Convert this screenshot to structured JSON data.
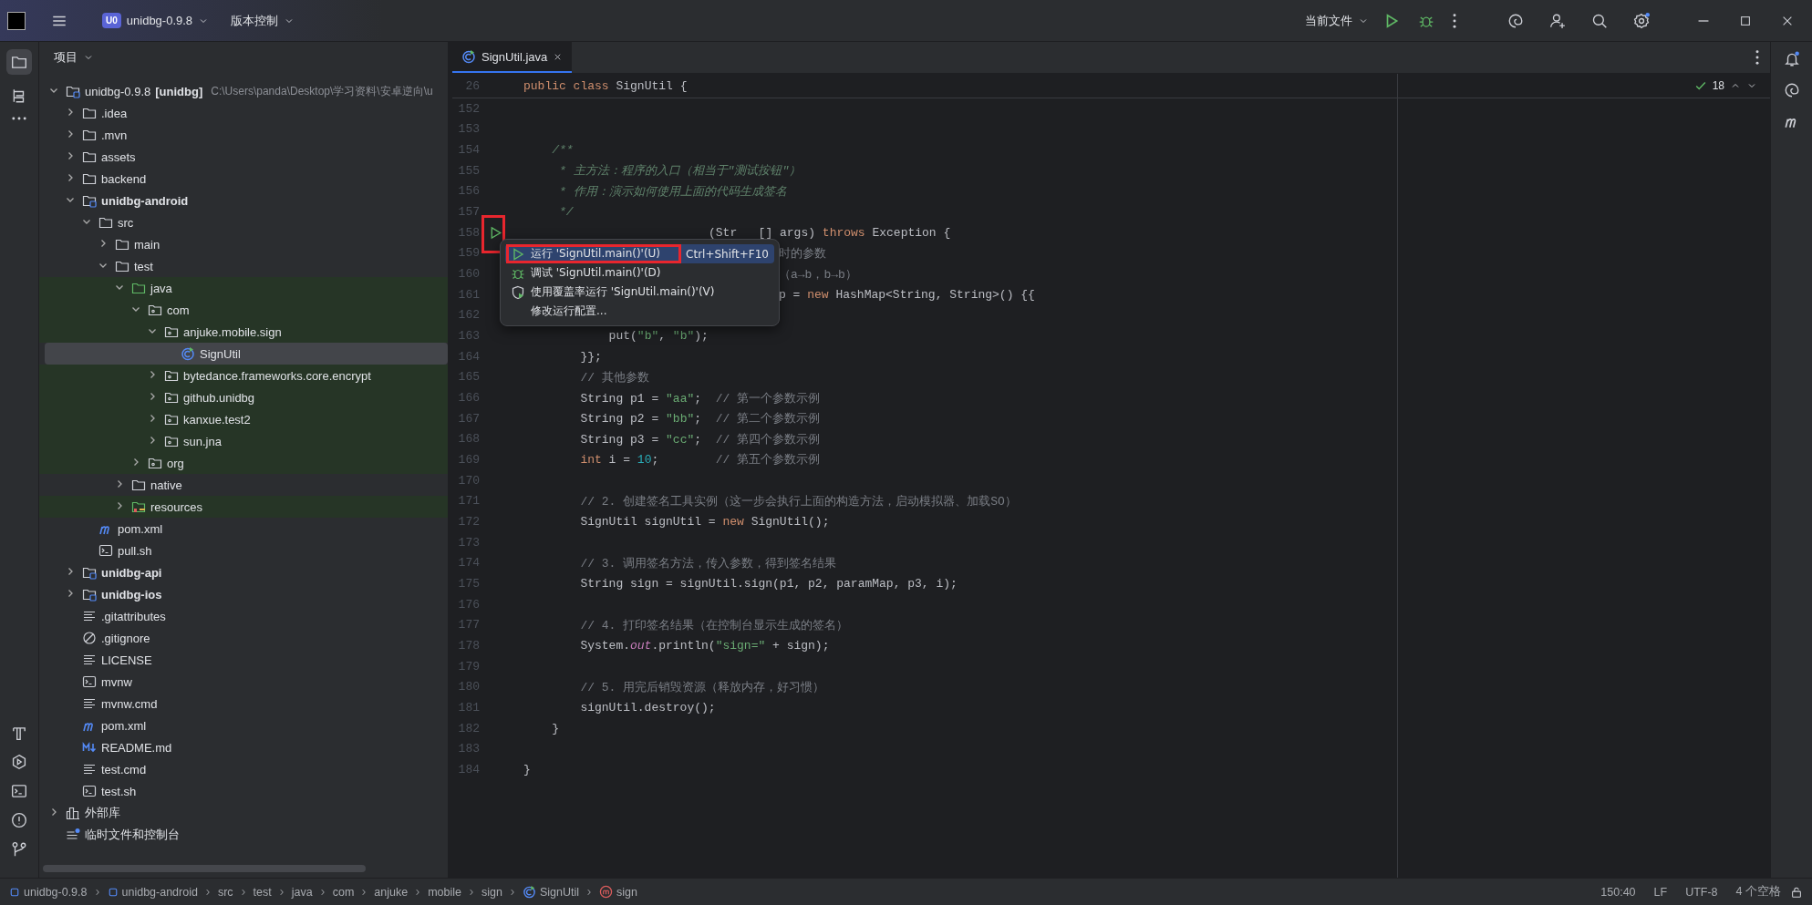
{
  "title_bar": {
    "project_badge": "U0",
    "project": "unidbg-0.9.8",
    "vcs": "版本控制",
    "run_config": "当前文件"
  },
  "project_panel": {
    "title": "项目",
    "tree": [
      {
        "label": "unidbg-0.9.8",
        "tag": "[unidbg]",
        "hint": "C:\\Users\\panda\\Desktop\\学习资料\\安卓逆向\\u",
        "kind": "module",
        "expanded": true,
        "selected": false,
        "children": [
          {
            "label": ".idea",
            "kind": "folder",
            "expanded": false,
            "selected": false
          },
          {
            "label": ".mvn",
            "kind": "folder",
            "expanded": false,
            "selected": false
          },
          {
            "label": "assets",
            "kind": "folder",
            "expanded": false,
            "selected": false
          },
          {
            "label": "backend",
            "kind": "folder",
            "expanded": false,
            "selected": false
          },
          {
            "label": "unidbg-android",
            "kind": "module",
            "bold": true,
            "expanded": true,
            "selected": false,
            "children": [
              {
                "label": "src",
                "kind": "folder",
                "expanded": true,
                "selected": false,
                "children": [
                  {
                    "label": "main",
                    "kind": "folder",
                    "expanded": false,
                    "selected": false
                  },
                  {
                    "label": "test",
                    "kind": "folder",
                    "expanded": true,
                    "selected": false,
                    "children": [
                      {
                        "label": "java",
                        "kind": "source",
                        "tinted": true,
                        "expanded": true,
                        "selected": false,
                        "children": [
                          {
                            "label": "com",
                            "kind": "package",
                            "tinted": true,
                            "expanded": true,
                            "selected": false,
                            "children": [
                              {
                                "label": "anjuke.mobile.sign",
                                "kind": "package",
                                "tinted": true,
                                "expanded": true,
                                "selected": false,
                                "children": [
                                  {
                                    "label": "SignUtil",
                                    "kind": "class",
                                    "tinted": true,
                                    "selected": true
                                  }
                                ]
                              },
                              {
                                "label": "bytedance.frameworks.core.encrypt",
                                "kind": "package",
                                "tinted": true,
                                "expanded": false,
                                "selected": false
                              },
                              {
                                "label": "github.unidbg",
                                "kind": "package",
                                "tinted": true,
                                "expanded": false,
                                "selected": false
                              },
                              {
                                "label": "kanxue.test2",
                                "kind": "package",
                                "tinted": true,
                                "expanded": false,
                                "selected": false
                              },
                              {
                                "label": "sun.jna",
                                "kind": "package",
                                "tinted": true,
                                "expanded": false,
                                "selected": false
                              }
                            ]
                          },
                          {
                            "label": "org",
                            "kind": "package",
                            "tinted": true,
                            "expanded": false,
                            "selected": false
                          }
                        ]
                      },
                      {
                        "label": "native",
                        "kind": "folder",
                        "expanded": false,
                        "selected": false
                      },
                      {
                        "label": "resources",
                        "kind": "resources",
                        "tinted": true,
                        "expanded": false,
                        "selected": false
                      }
                    ]
                  }
                ]
              },
              {
                "label": "pom.xml",
                "kind": "maven",
                "selected": false
              },
              {
                "label": "pull.sh",
                "kind": "shell",
                "selected": false
              }
            ]
          },
          {
            "label": "unidbg-api",
            "kind": "module",
            "bold": true,
            "expanded": false,
            "selected": false
          },
          {
            "label": "unidbg-ios",
            "kind": "module",
            "bold": true,
            "expanded": false,
            "selected": false
          },
          {
            "label": ".gitattributes",
            "kind": "text",
            "selected": false
          },
          {
            "label": ".gitignore",
            "kind": "ignore",
            "selected": false
          },
          {
            "label": "LICENSE",
            "kind": "text",
            "selected": false
          },
          {
            "label": "mvnw",
            "kind": "shell",
            "selected": false
          },
          {
            "label": "mvnw.cmd",
            "kind": "text",
            "selected": false
          },
          {
            "label": "pom.xml",
            "kind": "maven",
            "selected": false
          },
          {
            "label": "README.md",
            "kind": "markdown",
            "selected": false
          },
          {
            "label": "test.cmd",
            "kind": "text",
            "selected": false
          },
          {
            "label": "test.sh",
            "kind": "shell",
            "selected": false
          }
        ]
      },
      {
        "label": "外部库",
        "kind": "library",
        "expanded": false,
        "selected": false
      },
      {
        "label": "临时文件和控制台",
        "kind": "scratch",
        "selected": false
      }
    ]
  },
  "editor": {
    "tabs": [
      {
        "label": "SignUtil.java",
        "selected": true
      }
    ],
    "sticky_line": {
      "number": "26",
      "tokens": [
        {
          "text": "public class",
          "kind": "kw"
        },
        {
          "text": " SignUtil {",
          "kind": "plain"
        }
      ]
    },
    "inspection_count": "18",
    "lines": [
      {
        "number": "152"
      },
      {
        "number": "153"
      },
      {
        "number": "154",
        "tokens": [
          {
            "text": "    /**",
            "kind": "doc"
          }
        ]
      },
      {
        "number": "155",
        "tokens": [
          {
            "text": "     * 主方法：程序的入口（相当于\"测试按钮\"）",
            "kind": "doc"
          }
        ]
      },
      {
        "number": "156",
        "tokens": [
          {
            "text": "     * 作用：演示如何使用上面的代码生成签名",
            "kind": "doc"
          }
        ]
      },
      {
        "number": "157",
        "tokens": [
          {
            "text": "     */",
            "kind": "doc"
          }
        ]
      },
      {
        "number": "158",
        "run_marker": true,
        "run_marker_framed": true,
        "occluded": true,
        "tokens": [
          {
            "text": "(Str   [] args) ",
            "kind": "plain"
          },
          {
            "text": "throws",
            "kind": "kw"
          },
          {
            "text": " Exception {",
            "kind": "plain"
          }
        ]
      },
      {
        "number": "159",
        "occluded": true,
        "tokens": [
          {
            "text": "时的参数",
            "kind": "comment"
          }
        ]
      },
      {
        "number": "160",
        "occluded": true,
        "tokens": [
          {
            "text": "（a→b，b→b）",
            "kind": "comment"
          }
        ]
      },
      {
        "number": "161",
        "occluded": true,
        "tokens": [
          {
            "text": "p = ",
            "kind": "plain"
          },
          {
            "text": "new",
            "kind": "kw"
          },
          {
            "text": " HashMap<String, String>() {{",
            "kind": "plain"
          }
        ]
      },
      {
        "number": "162"
      },
      {
        "number": "163",
        "tokens": [
          {
            "text": "            put(",
            "kind": "plain"
          },
          {
            "text": "\"b\"",
            "kind": "str"
          },
          {
            "text": ", ",
            "kind": "plain"
          },
          {
            "text": "\"b\"",
            "kind": "str"
          },
          {
            "text": ");",
            "kind": "plain"
          }
        ]
      },
      {
        "number": "164",
        "tokens": [
          {
            "text": "        }};",
            "kind": "plain"
          }
        ]
      },
      {
        "number": "165",
        "tokens": [
          {
            "text": "        // 其他参数",
            "kind": "comment"
          }
        ]
      },
      {
        "number": "166",
        "tokens": [
          {
            "text": "        String p1 = ",
            "kind": "plain"
          },
          {
            "text": "\"aa\"",
            "kind": "str"
          },
          {
            "text": ";  ",
            "kind": "plain"
          },
          {
            "text": "// 第一个参数示例",
            "kind": "comment"
          }
        ]
      },
      {
        "number": "167",
        "tokens": [
          {
            "text": "        String p2 = ",
            "kind": "plain"
          },
          {
            "text": "\"bb\"",
            "kind": "str"
          },
          {
            "text": ";  ",
            "kind": "plain"
          },
          {
            "text": "// 第二个参数示例",
            "kind": "comment"
          }
        ]
      },
      {
        "number": "168",
        "tokens": [
          {
            "text": "        String p3 = ",
            "kind": "plain"
          },
          {
            "text": "\"cc\"",
            "kind": "str"
          },
          {
            "text": ";  ",
            "kind": "plain"
          },
          {
            "text": "// 第四个参数示例",
            "kind": "comment"
          }
        ]
      },
      {
        "number": "169",
        "tokens": [
          {
            "text": "        int",
            "kind": "kw"
          },
          {
            "text": " i = ",
            "kind": "plain"
          },
          {
            "text": "10",
            "kind": "num"
          },
          {
            "text": ";        ",
            "kind": "plain"
          },
          {
            "text": "// 第五个参数示例",
            "kind": "comment"
          }
        ]
      },
      {
        "number": "170"
      },
      {
        "number": "171",
        "tokens": [
          {
            "text": "        // 2. 创建签名工具实例（这一步会执行上面的构造方法，启动模拟器、加载SO）",
            "kind": "comment"
          }
        ]
      },
      {
        "number": "172",
        "tokens": [
          {
            "text": "        SignUtil signUtil = ",
            "kind": "plain"
          },
          {
            "text": "new",
            "kind": "kw"
          },
          {
            "text": " SignUtil();",
            "kind": "plain"
          }
        ]
      },
      {
        "number": "173"
      },
      {
        "number": "174",
        "tokens": [
          {
            "text": "        // 3. 调用签名方法，传入参数，得到签名结果",
            "kind": "comment"
          }
        ]
      },
      {
        "number": "175",
        "tokens": [
          {
            "text": "        String sign = signUtil.sign(p1, p2, paramMap, p3, i);",
            "kind": "plain"
          }
        ]
      },
      {
        "number": "176"
      },
      {
        "number": "177",
        "tokens": [
          {
            "text": "        // 4. 打印签名结果（在控制台显示生成的签名）",
            "kind": "comment"
          }
        ]
      },
      {
        "number": "178",
        "tokens": [
          {
            "text": "        System.",
            "kind": "plain"
          },
          {
            "text": "out",
            "kind": "field"
          },
          {
            "text": ".println(",
            "kind": "plain"
          },
          {
            "text": "\"sign=\"",
            "kind": "str"
          },
          {
            "text": " + sign);",
            "kind": "plain"
          }
        ]
      },
      {
        "number": "179"
      },
      {
        "number": "180",
        "tokens": [
          {
            "text": "        // 5. 用完后销毁资源（释放内存，好习惯）",
            "kind": "comment"
          }
        ]
      },
      {
        "number": "181",
        "tokens": [
          {
            "text": "        signUtil.destroy();",
            "kind": "plain"
          }
        ]
      },
      {
        "number": "182",
        "tokens": [
          {
            "text": "    }",
            "kind": "plain"
          }
        ]
      },
      {
        "number": "183"
      },
      {
        "number": "184",
        "tokens": [
          {
            "text": "}",
            "kind": "plain"
          }
        ]
      }
    ],
    "popup": {
      "items": [
        {
          "kind": "run",
          "label": "运行 'SignUtil.main()'(U)",
          "shortcut": "Ctrl+Shift+F10",
          "selected": true,
          "framed": true
        },
        {
          "kind": "debug",
          "label": "调试 'SignUtil.main()'(D)",
          "selected": false
        },
        {
          "kind": "coverage",
          "label": "使用覆盖率运行 'SignUtil.main()'(V)",
          "selected": false
        },
        {
          "kind": "none",
          "label": "修改运行配置...",
          "selected": false
        }
      ]
    }
  },
  "status_bar": {
    "breadcrumbs": [
      {
        "label": "unidbg-0.9.8",
        "kind": "module"
      },
      {
        "label": "unidbg-android",
        "kind": "module"
      },
      {
        "label": "src",
        "kind": "folder"
      },
      {
        "label": "test",
        "kind": "folder"
      },
      {
        "label": "java",
        "kind": "folder"
      },
      {
        "label": "com",
        "kind": "folder"
      },
      {
        "label": "anjuke",
        "kind": "folder"
      },
      {
        "label": "mobile",
        "kind": "folder"
      },
      {
        "label": "sign",
        "kind": "folder"
      },
      {
        "label": "SignUtil",
        "kind": "class"
      },
      {
        "label": "sign",
        "kind": "method"
      }
    ],
    "position": "150:40",
    "line_ending": "LF",
    "encoding": "UTF-8",
    "indent": "4 个空格"
  }
}
